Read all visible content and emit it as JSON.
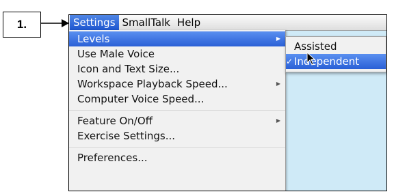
{
  "step": {
    "label": "1."
  },
  "menubar": {
    "items": [
      "Settings",
      "SmallTalk",
      "Help"
    ]
  },
  "settings_menu": {
    "items": [
      {
        "label": "Levels",
        "has_submenu": true,
        "highlighted": true
      },
      {
        "label": "Use Male Voice",
        "has_submenu": false
      },
      {
        "label": "Icon and Text Size...",
        "has_submenu": false
      },
      {
        "label": "Workspace Playback Speed...",
        "has_submenu": true
      },
      {
        "label": "Computer Voice Speed...",
        "has_submenu": false
      },
      {
        "label": "Feature On/Off",
        "has_submenu": true
      },
      {
        "label": "Exercise Settings...",
        "has_submenu": false
      },
      {
        "label": "Preferences...",
        "has_submenu": false
      }
    ]
  },
  "levels_submenu": {
    "items": [
      {
        "label": "Assisted",
        "checked": false
      },
      {
        "label": "Independent",
        "checked": true,
        "highlighted": true
      }
    ]
  },
  "colors": {
    "highlight": "#2a60d6",
    "menu_bg": "#f1f1f1",
    "desktop_bg": "#cfeaf7"
  },
  "icons": {
    "submenu_indicator": "chevron-right-icon",
    "check": "checkmark-icon",
    "pointer": "mouse-cursor-icon"
  }
}
